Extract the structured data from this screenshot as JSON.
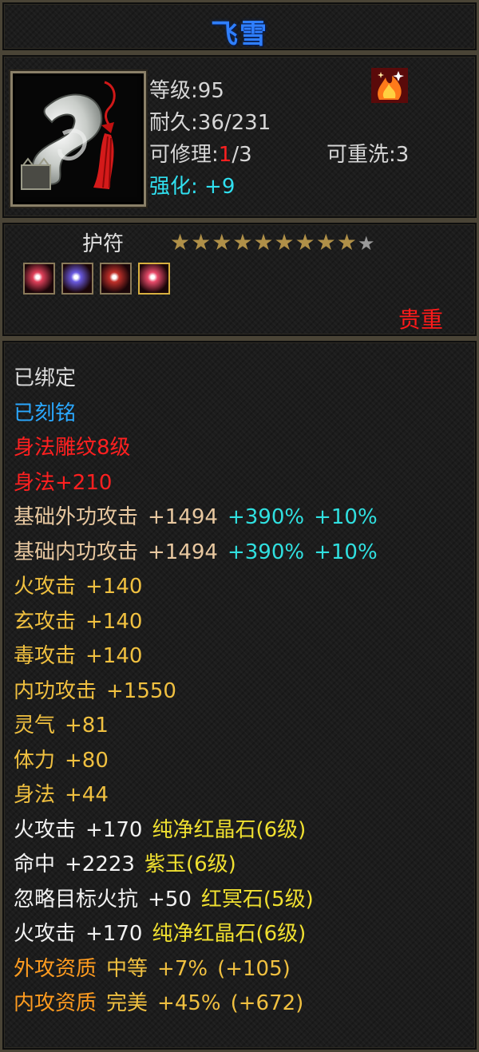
{
  "item": {
    "name": "飞雪",
    "level_label": "等级",
    "level_value": "95",
    "durability_label": "耐久",
    "durability_value": "36/231",
    "repair_label": "可修理",
    "repair_current": "1",
    "repair_total": "/3",
    "rewash_label": "可重洗",
    "rewash_value": "3",
    "enhance_label": "强化",
    "enhance_value": "+9",
    "type": "护符",
    "stars_filled": 9,
    "stars_total": 10,
    "rarity": "贵重"
  },
  "gems": [
    {
      "name": "red-gem-icon",
      "color": "#e0405a",
      "border": "#8a7a5a"
    },
    {
      "name": "purple-gem-icon",
      "color": "#6a5ae0",
      "border": "#8a7a5a"
    },
    {
      "name": "crimson-gem-icon",
      "color": "#c0302a",
      "border": "#8a7a5a"
    },
    {
      "name": "rose-gem-icon",
      "color": "#e84a6a",
      "border": "#d8b040"
    }
  ],
  "attributes": [
    {
      "segments": [
        {
          "text": "已绑定",
          "color": "#dcdcdc"
        }
      ]
    },
    {
      "segments": [
        {
          "text": "已刻铭",
          "color": "#2aa8ff"
        }
      ]
    },
    {
      "segments": [
        {
          "text": "身法雕纹8级",
          "color": "#ff2020"
        }
      ]
    },
    {
      "segments": [
        {
          "text": "身法+210",
          "color": "#ff2020"
        }
      ]
    },
    {
      "segments": [
        {
          "text": "基础外功攻击",
          "color": "#e8c8a0"
        },
        {
          "text": "+1494",
          "color": "#e8c8a0"
        },
        {
          "text": "+390%",
          "color": "#30e0e0"
        },
        {
          "text": "+10%",
          "color": "#30e0e0"
        }
      ]
    },
    {
      "segments": [
        {
          "text": "基础内功攻击",
          "color": "#e8c8a0"
        },
        {
          "text": "+1494",
          "color": "#e8c8a0"
        },
        {
          "text": "+390%",
          "color": "#30e0e0"
        },
        {
          "text": "+10%",
          "color": "#30e0e0"
        }
      ]
    },
    {
      "segments": [
        {
          "text": "火攻击",
          "color": "#f0c040"
        },
        {
          "text": "+140",
          "color": "#f0c040"
        }
      ]
    },
    {
      "segments": [
        {
          "text": "玄攻击",
          "color": "#f0c040"
        },
        {
          "text": "+140",
          "color": "#f0c040"
        }
      ]
    },
    {
      "segments": [
        {
          "text": "毒攻击",
          "color": "#f0c040"
        },
        {
          "text": "+140",
          "color": "#f0c040"
        }
      ]
    },
    {
      "segments": [
        {
          "text": "内功攻击",
          "color": "#f0c040"
        },
        {
          "text": "+1550",
          "color": "#f0c040"
        }
      ]
    },
    {
      "segments": [
        {
          "text": "灵气",
          "color": "#f0c040"
        },
        {
          "text": "+81",
          "color": "#f0c040"
        }
      ]
    },
    {
      "segments": [
        {
          "text": "体力",
          "color": "#f0c040"
        },
        {
          "text": "+80",
          "color": "#f0c040"
        }
      ]
    },
    {
      "segments": [
        {
          "text": "身法",
          "color": "#f0c040"
        },
        {
          "text": "+44",
          "color": "#f0c040"
        }
      ]
    },
    {
      "segments": [
        {
          "text": "火攻击",
          "color": "#f2f2f2"
        },
        {
          "text": "+170",
          "color": "#f2f2f2"
        },
        {
          "text": "纯净红晶石(6级)",
          "color": "#f0e030"
        }
      ]
    },
    {
      "segments": [
        {
          "text": "命中",
          "color": "#f2f2f2"
        },
        {
          "text": "+2223",
          "color": "#f2f2f2"
        },
        {
          "text": "紫玉(6级)",
          "color": "#f0e030"
        }
      ]
    },
    {
      "segments": [
        {
          "text": "忽略目标火抗",
          "color": "#f2f2f2"
        },
        {
          "text": "+50",
          "color": "#f2f2f2"
        },
        {
          "text": "红冥石(5级)",
          "color": "#f0e030"
        }
      ]
    },
    {
      "segments": [
        {
          "text": "火攻击",
          "color": "#f2f2f2"
        },
        {
          "text": "+170",
          "color": "#f2f2f2"
        },
        {
          "text": "纯净红晶石(6级)",
          "color": "#f0e030"
        }
      ]
    },
    {
      "segments": [
        {
          "text": "外攻资质",
          "color": "#ff9c20"
        },
        {
          "text": "中等",
          "color": "#f0c040"
        },
        {
          "text": "+7%",
          "color": "#f0c040"
        },
        {
          "text": "(+105)",
          "color": "#f0c040"
        }
      ]
    },
    {
      "segments": [
        {
          "text": "内攻资质",
          "color": "#ff9c20"
        },
        {
          "text": "完美",
          "color": "#f0c040"
        },
        {
          "text": "+45%",
          "color": "#f0c040"
        },
        {
          "text": "(+672)",
          "color": "#f0c040"
        }
      ]
    }
  ],
  "colors": {
    "title": "#2f7fff",
    "label": "#d7d7d7",
    "enhance": "#30e0f0",
    "repair_current": "#ff2020",
    "star_filled": "#b09048",
    "star_empty": "#9a9a9a",
    "rarity": "#ff1a1a",
    "type_label": "#e0e0e0"
  }
}
